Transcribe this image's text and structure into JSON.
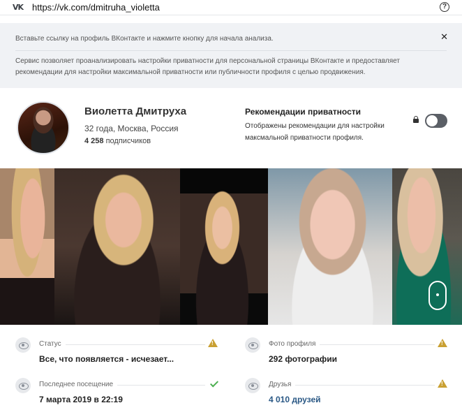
{
  "browser": {
    "url": "https://vk.com/dmitruha_violetta",
    "logo_text": "VK",
    "help_symbol": "?"
  },
  "info": {
    "hint": "Вставьте ссылку на профиль ВКонтакте и нажмите кнопку для начала анализа.",
    "description": "Сервис позволяет проанализировать настройки приватности для персональной страницы ВКонтакте и предоставляет рекомендации для настройки максимальной приватности или публичности профиля с целью продвижения.",
    "close_symbol": "✕"
  },
  "profile": {
    "name": "Виолетта Дмитруха",
    "details": "32 года, Москва, Россия",
    "subscribers_count": "4 258",
    "subscribers_label": "подписчиков"
  },
  "recommendations": {
    "title": "Рекомендации приватности",
    "description": "Отображены рекомендации для настройки максмальной приватности профиля.",
    "toggle_on": false
  },
  "stats": [
    {
      "label": "Статус",
      "value": "Все, что появляется - исчезает...",
      "indicator": "warning"
    },
    {
      "label": "Фото профиля",
      "value": "292 фотографии",
      "indicator": "warning"
    },
    {
      "label": "Последнее посещение",
      "value": "7 марта 2019 в 22:19",
      "indicator": "ok"
    },
    {
      "label": "Друзья",
      "value": "4 010 друзей",
      "indicator": "warning"
    }
  ],
  "colors": {
    "warning": "#c9a033",
    "ok": "#4caf50",
    "link": "#2a5885",
    "toggle_off": "#5b5f66"
  }
}
